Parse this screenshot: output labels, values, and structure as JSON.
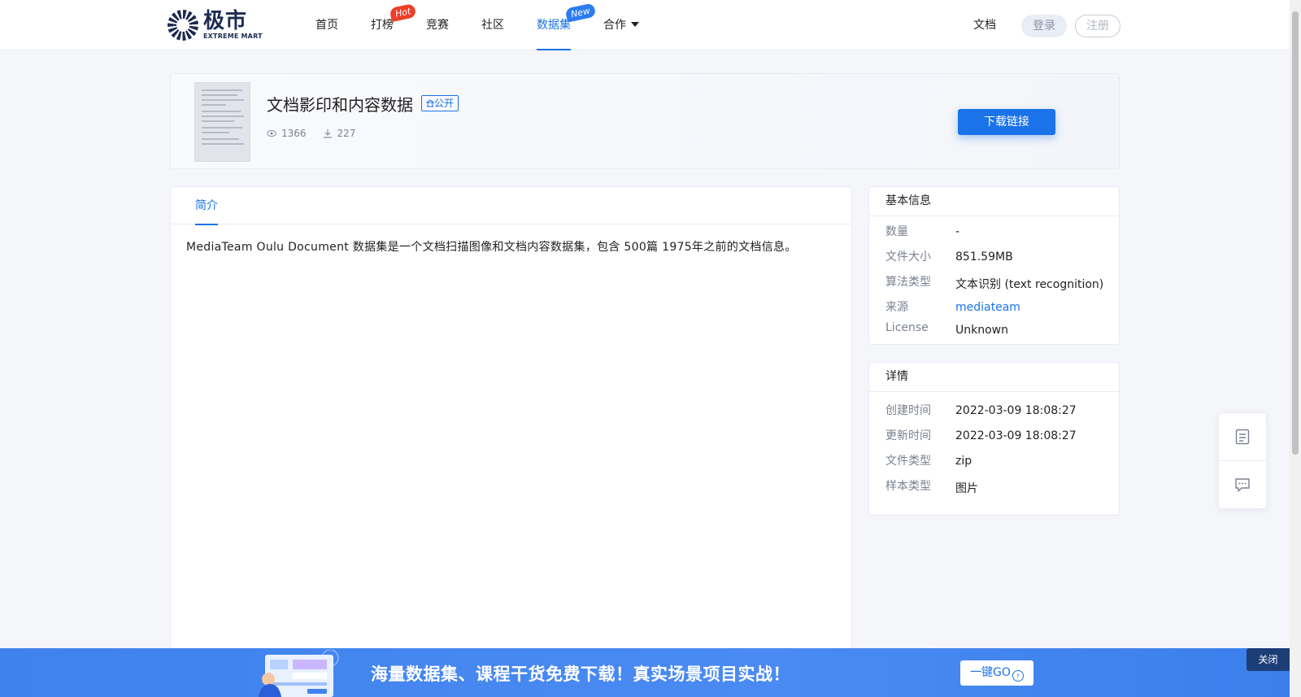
{
  "header": {
    "logo_cn": "极市",
    "logo_en": "EXTREME MART",
    "nav": [
      {
        "label": "首页"
      },
      {
        "label": "打榜",
        "badge": "Hot"
      },
      {
        "label": "竞赛"
      },
      {
        "label": "社区"
      },
      {
        "label": "数据集",
        "badge": "New",
        "active": true
      },
      {
        "label": "合作",
        "dropdown": true
      }
    ],
    "doc_link": "文档",
    "login": "登录",
    "register": "注册"
  },
  "dataset": {
    "title": "文档影印和内容数据",
    "visibility": "公开",
    "views": "1366",
    "downloads": "227",
    "download_button": "下载链接"
  },
  "main": {
    "tab": "简介",
    "intro": "MediaTeam Oulu Document 数据集是一个文档扫描图像和文档内容数据集，包含 500篇 1975年之前的文档信息。"
  },
  "basic_info": {
    "title": "基本信息",
    "rows": [
      {
        "key": "数量",
        "value": "-"
      },
      {
        "key": "文件大小",
        "value": "851.59MB"
      },
      {
        "key": "算法类型",
        "value": "文本识别 (text recognition)"
      },
      {
        "key": "来源",
        "value": "mediateam"
      },
      {
        "key": "License",
        "value": "Unknown"
      }
    ]
  },
  "details": {
    "title": "详情",
    "rows": [
      {
        "key": "创建时间",
        "value": "2022-03-09 18:08:27"
      },
      {
        "key": "更新时间",
        "value": "2022-03-09 18:08:27"
      },
      {
        "key": "文件类型",
        "value": "zip"
      },
      {
        "key": "样本类型",
        "value": "图片"
      }
    ]
  },
  "banner": {
    "text": "海量数据集、课程干货免费下载！真实场景项目实战！",
    "go_button": "一键GO",
    "close": "关闭"
  },
  "colors": {
    "accent": "#1a73e8",
    "hot": "#ee3e27",
    "banner": "#4a8af2"
  }
}
